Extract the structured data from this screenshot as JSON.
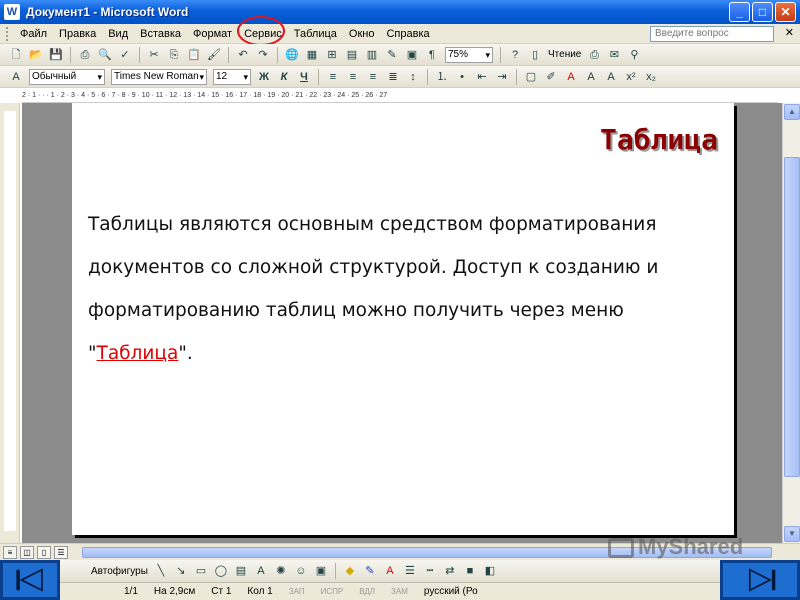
{
  "window": {
    "title": "Документ1 - Microsoft Word",
    "app_icon": "W",
    "buttons": {
      "minimize": "_",
      "maximize": "□",
      "close": "✕"
    }
  },
  "menu": {
    "items": [
      "Файл",
      "Правка",
      "Вид",
      "Вставка",
      "Формат",
      "Сервис",
      "Таблица",
      "Окно",
      "Справка"
    ],
    "help_placeholder": "Введите вопрос",
    "close_doc": "✕"
  },
  "toolbar_standard": {
    "zoom": "75%",
    "reading": "Чтение"
  },
  "toolbar_format": {
    "style": "Обычный",
    "font": "Times New Roman",
    "size": "12",
    "bold": "Ж",
    "italic": "К",
    "underline": "Ч"
  },
  "ruler": {
    "text": "2 · 1 · · · 1 · 2 · 3 · 4 · 5 · 6 · 7 · 8 · 9 · 10 · 11 · 12 · 13 · 14 · 15 · 16 · 17 · 18 · 19 · 20 · 21 · 22 · 23 · 24 · 25 · 26 · 27"
  },
  "document": {
    "heading": "Таблица",
    "body_part1": "Таблицы являются основным средством форматирования документов со сложной структурой. Доступ к созданию и форматированию таблиц можно получить через меню \"",
    "link": "Таблица",
    "body_part2": "\"."
  },
  "drawing_toolbar": {
    "autoshapes": "Автофигуры"
  },
  "status": {
    "page": "1/1",
    "at": "На 2,9см",
    "line": "Ст 1",
    "col": "Кол 1",
    "rec": "ЗАП",
    "trk": "ИСПР",
    "ext": "ВДЛ",
    "ovr": "ЗАМ",
    "lang": "русский (Ро"
  },
  "watermark": "MyShared",
  "colors": {
    "title_blue": "#0a5fd8",
    "heading": "#8b0000",
    "link_red": "#e00000",
    "circle": "#e4141e",
    "nav_blue": "#1e6ed2"
  }
}
